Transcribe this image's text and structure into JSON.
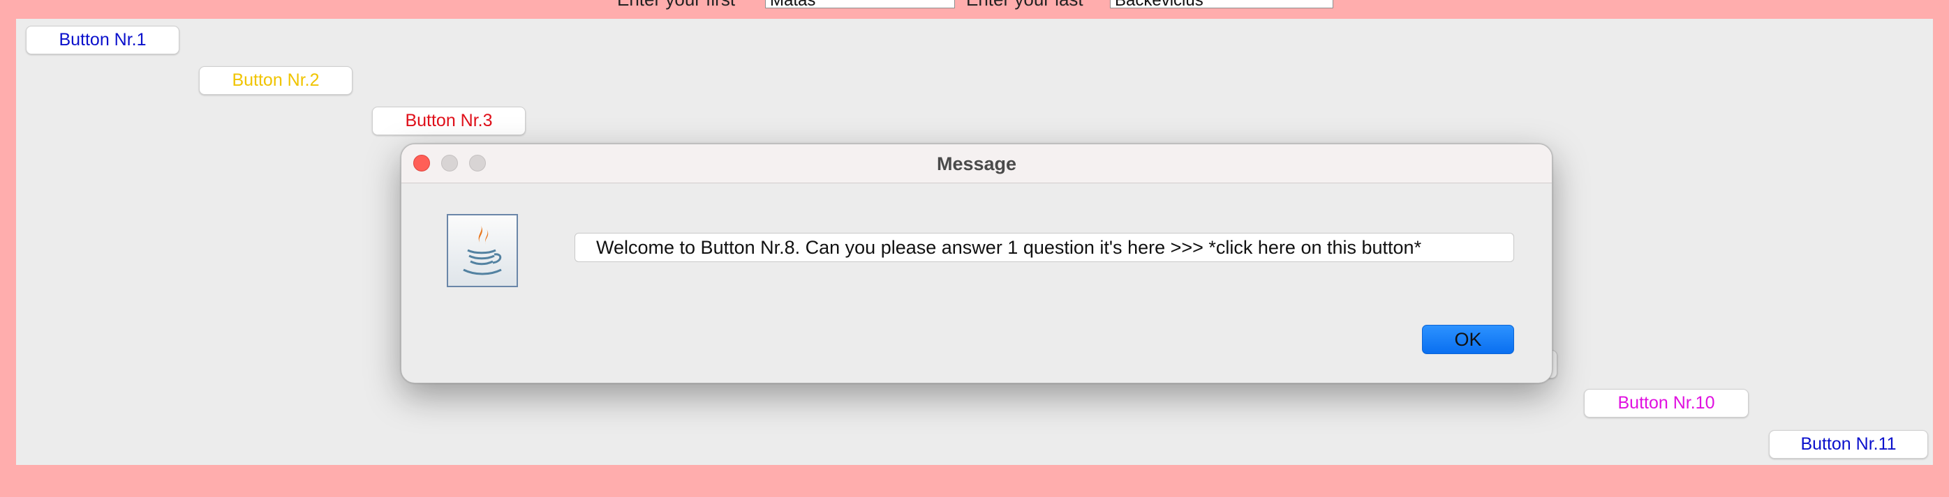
{
  "form": {
    "first_label": "Enter your first",
    "first_value": "Matas",
    "last_label": "Enter your last",
    "last_value": "Backevicius"
  },
  "buttons": [
    {
      "label": "Button Nr.1",
      "color": "#0a10cc"
    },
    {
      "label": "Button Nr.2",
      "color": "#f0c400"
    },
    {
      "label": "Button Nr.3",
      "color": "#e0101a"
    },
    {
      "label": "Button Nr.10",
      "color": "#e010e0"
    },
    {
      "label": "Button Nr.11",
      "color": "#0a10cc"
    }
  ],
  "dialog": {
    "title": "Message",
    "message": "Welcome to Button Nr.8.  Can you please answer 1 question it's here  >>> *click here on this button*",
    "ok_label": "OK",
    "icon": "java-coffee-cup-icon"
  },
  "colors": {
    "background": "#ffadad",
    "panel": "#ececec",
    "ok_button": "#1a7ff8",
    "close_light": "#ff5f57"
  }
}
